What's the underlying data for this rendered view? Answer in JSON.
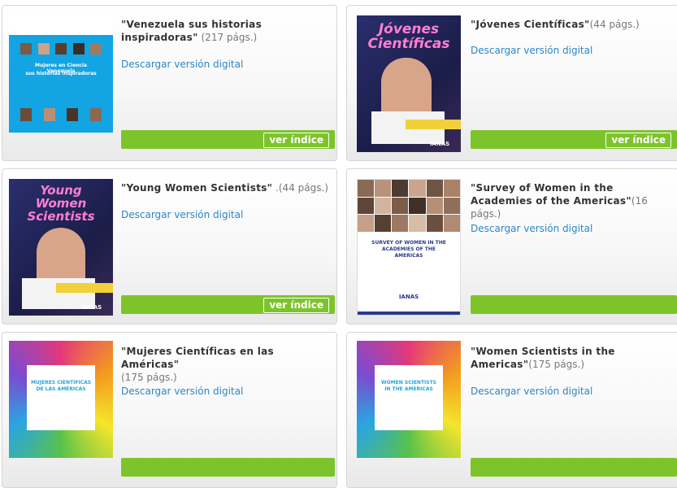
{
  "colors": {
    "accent_green": "#7dc42b",
    "link_blue": "#2d86c5"
  },
  "publications": [
    {
      "title": "\"Venezuela sus historias inspiradoras\"",
      "pages": "(217 págs.)",
      "download": "Descargar versión digital",
      "button": "ver índice",
      "cover": {
        "lines": [
          "Mujeres en Ciencia Venezuela",
          "sus historias inspiradoras"
        ]
      }
    },
    {
      "title": "\"Jóvenes Científicas\"",
      "pages": "(44 págs.)",
      "download": "Descargar versión digital",
      "button": "ver índice",
      "cover": {
        "heading": "Jóvenes Científicas",
        "brand": "IANAS"
      }
    },
    {
      "title": "\"Young Women Scientists\"",
      "pages": ".(44 págs.)",
      "download": "Descargar versión digital",
      "button": "ver índice",
      "cover": {
        "heading": "Young Women Scientists",
        "brand": "IANAS"
      }
    },
    {
      "title": "\"Survey of Women in the Academies of the Americas\"",
      "pages": "(16 págs.)",
      "download": "Descargar versión digital",
      "button": "",
      "cover": {
        "heading": "SURVEY OF WOMEN IN THE ACADEMIES OF THE AMERICAS",
        "brand": "IANAS"
      }
    },
    {
      "title": "\"Mujeres Científicas en las Américas\"",
      "pages": "(175 págs.)",
      "download": "Descargar versión digital",
      "button": "",
      "cover": {
        "heading": "MUJERES CIENTÍFICAS DE LAS AMÉRICAS"
      }
    },
    {
      "title": "\"Women Scientists in the Americas\"",
      "pages": "(175 págs.)",
      "download": "Descargar versión digital",
      "button": "",
      "cover": {
        "heading": "WOMEN SCIENTISTS IN THE AMERICAS"
      }
    }
  ]
}
